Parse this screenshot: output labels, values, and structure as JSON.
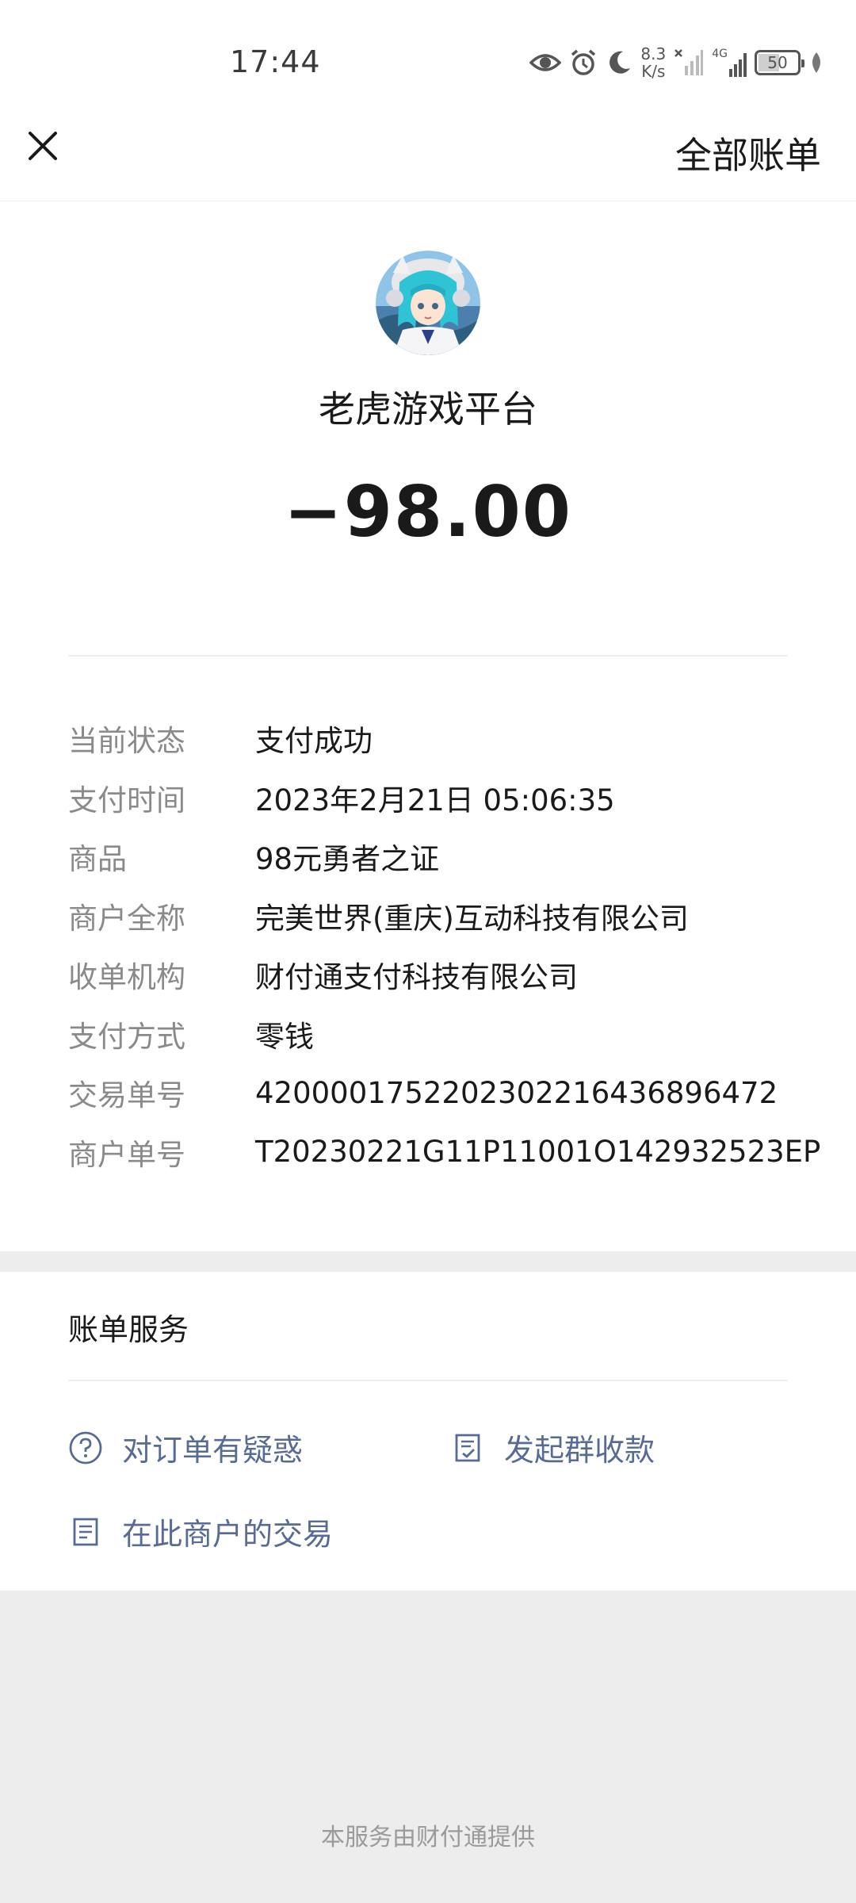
{
  "status_bar": {
    "time": "17:44",
    "net_speed_value": "8.3",
    "net_speed_unit": "K/s",
    "network_type": "4G",
    "battery_level": "50",
    "icons": [
      "eye-icon",
      "alarm-icon",
      "moon-icon",
      "signal-off-icon",
      "signal-4g-icon",
      "battery-icon",
      "leaf-icon"
    ]
  },
  "header": {
    "close_icon": "close-icon",
    "all_bills_label": "全部账单"
  },
  "transaction": {
    "merchant_name": "老虎游戏平台",
    "amount": "−98.00",
    "details": [
      {
        "label": "当前状态",
        "value": "支付成功"
      },
      {
        "label": "支付时间",
        "value": "2023年2月21日 05:06:35"
      },
      {
        "label": "商品",
        "value": "98元勇者之证"
      },
      {
        "label": "商户全称",
        "value": "完美世界(重庆)互动科技有限公司"
      },
      {
        "label": "收单机构",
        "value": "财付通支付科技有限公司"
      },
      {
        "label": "支付方式",
        "value": "零钱"
      },
      {
        "label": "交易单号",
        "value": "4200001752202302216436896472"
      },
      {
        "label": "商户单号",
        "value": "T20230221G11P11001O142932523EP"
      }
    ]
  },
  "bill_service": {
    "title": "账单服务",
    "items": [
      {
        "label": "对订单有疑惑",
        "icon": "question-circle-icon"
      },
      {
        "label": "发起群收款",
        "icon": "document-check-icon"
      },
      {
        "label": "在此商户的交易",
        "icon": "document-list-icon"
      }
    ]
  },
  "footer": {
    "note": "本服务由财付通提供"
  },
  "colors": {
    "link": "#576b95",
    "label_gray": "#8a8a8a",
    "background": "#ededed"
  }
}
